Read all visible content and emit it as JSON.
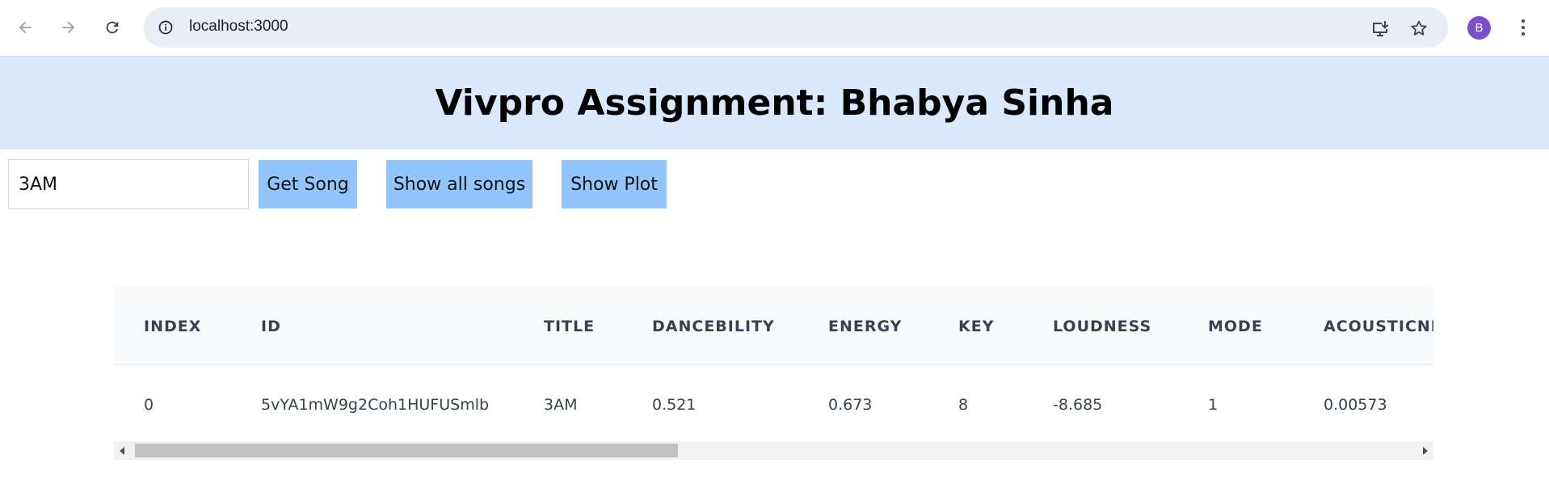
{
  "browser": {
    "url": "localhost:3000",
    "profile_initial": "B",
    "icons": [
      "back-arrow-icon",
      "forward-arrow-icon",
      "reload-icon",
      "site-info-icon",
      "install-app-icon",
      "star-icon",
      "more-menu-icon"
    ]
  },
  "page": {
    "title": "Vivpro Assignment: Bhabya Sinha"
  },
  "controls": {
    "search_value": "3AM",
    "get_song_label": "Get Song",
    "show_all_label": "Show all songs",
    "show_plot_label": "Show Plot"
  },
  "table": {
    "headers": [
      "INDEX",
      "ID",
      "TITLE",
      "DANCEBILITY",
      "ENERGY",
      "KEY",
      "LOUDNESS",
      "MODE",
      "ACOUSTICNE"
    ],
    "rows": [
      [
        "0",
        "5vYA1mW9g2Coh1HUFUSmlb",
        "3AM",
        "0.521",
        "0.673",
        "8",
        "-8.685",
        "1",
        "0.00573"
      ]
    ]
  },
  "colors": {
    "header_band": "#dbe9fe",
    "button_bg": "#93c5fd",
    "table_header_bg": "#f9fafb",
    "avatar": "#7c4dcc"
  }
}
